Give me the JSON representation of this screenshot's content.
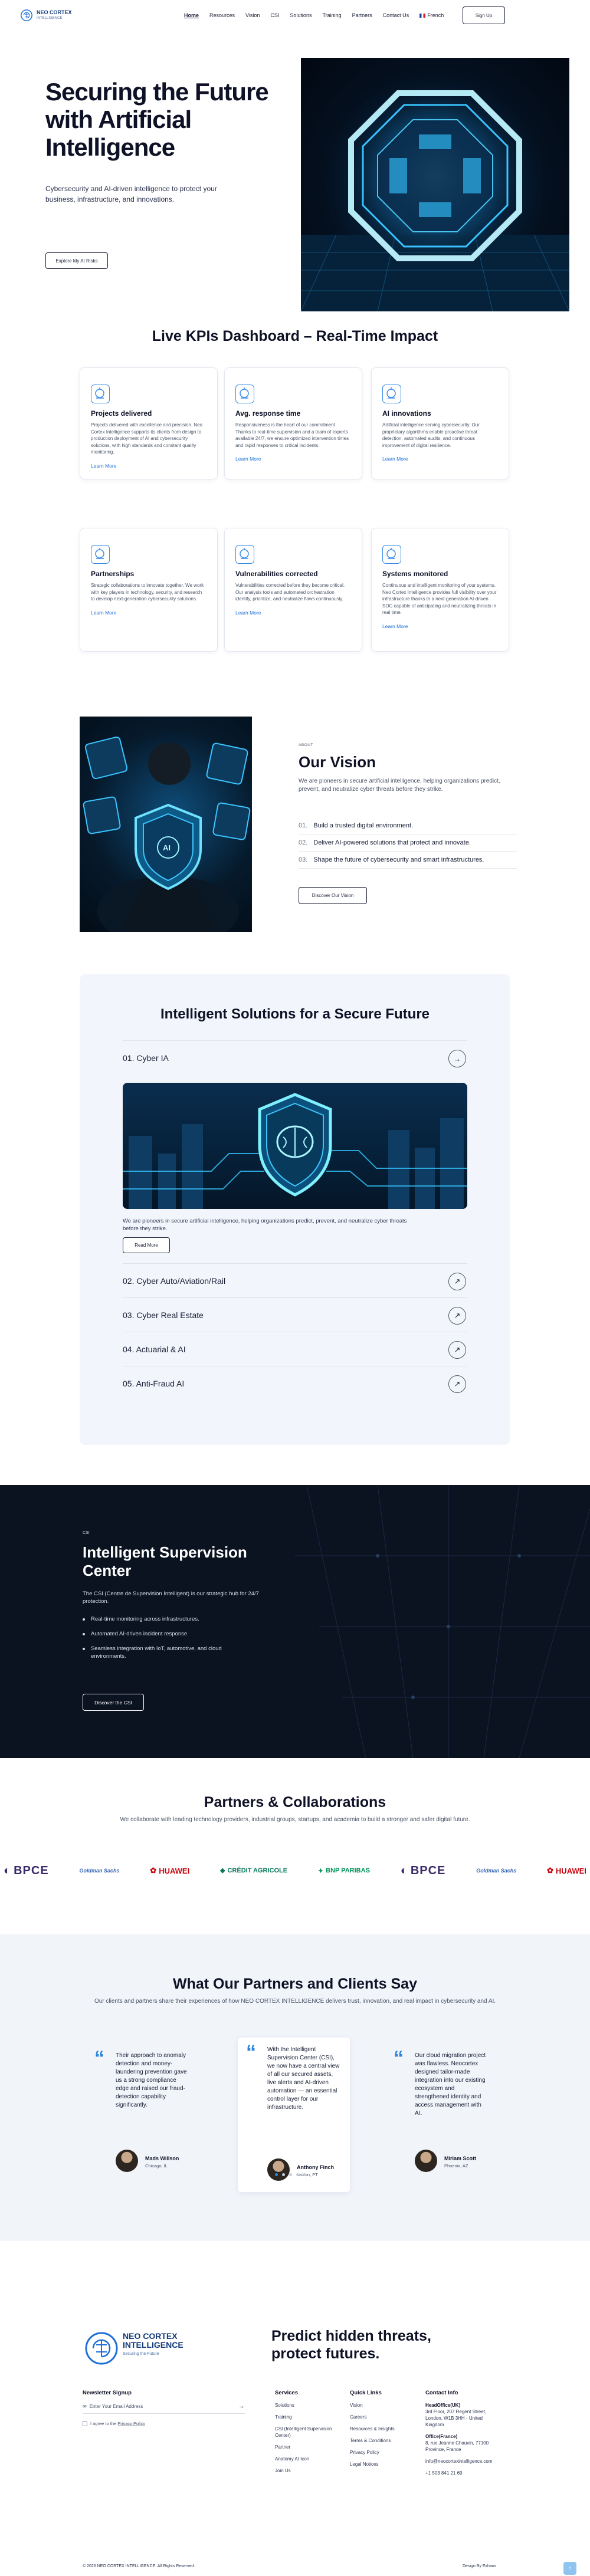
{
  "header": {
    "logo_line1": "NEO CORTEX",
    "logo_line2": "INTELLIGENCE",
    "nav": [
      "Home",
      "Resources",
      "Vision",
      "CSI",
      "Solutions",
      "Training",
      "Partners",
      "Contact Us"
    ],
    "lang": "French",
    "signup": "Sign Up"
  },
  "hero": {
    "title": "Securing the Future with Artificial Intelligence",
    "text": "Cybersecurity and AI-driven intelligence to protect your business, infrastructure, and innovations.",
    "button": "Explore My AI Risks"
  },
  "kpi": {
    "title": "Live KPIs Dashboard – Real-Time Impact",
    "learn_more": "Learn More",
    "cards": [
      {
        "icon": "magnifier-chart-icon",
        "title": "Projects delivered",
        "text": "Projects delivered with excellence and precision. Neo Cortex Intelligence supports its clients from design to production deployment of AI and cybersecurity solutions, with high standards and constant quality monitoring."
      },
      {
        "icon": "stopwatch-icon",
        "title": "Avg. response time",
        "text": "Responsiveness is the heart of our commitment. Thanks to real-time supervision and a team of experts available 24/7, we ensure optimized intervention times and rapid responses to critical incidents."
      },
      {
        "icon": "ai-chip-icon",
        "title": "AI innovations",
        "text": "Artificial intelligence serving cybersecurity. Our proprietary algorithms enable proactive threat detection, automated audits, and continuous improvement of digital resilience."
      },
      {
        "icon": "handshake-icon",
        "title": "Partnerships",
        "text": "Strategic collaborations to innovate together. We work with key players in technology, security, and research to develop next-generation cybersecurity solutions."
      },
      {
        "icon": "grid-shield-icon",
        "title": "Vulnerabilities corrected",
        "text": "Vulnerabilities corrected before they become critical. Our analysis tools and automated orchestration identify, prioritize, and neutralize flaws continuously."
      },
      {
        "icon": "monitor-gear-icon",
        "title": "Systems monitored",
        "text": "Continuous and intelligent monitoring of your systems. Neo Cortex Intelligence provides full visibility over your infrastructure thanks to a next-generation AI-driven SOC capable of anticipating and neutralizing threats in real time."
      }
    ]
  },
  "vision": {
    "small": "ABOUT",
    "title": "Our Vision",
    "text": "We are pioneers in secure artificial intelligence, helping organizations predict, prevent, and neutralize cyber threats before they strike.",
    "items": [
      {
        "num": "01.",
        "text": "Build a trusted digital environment."
      },
      {
        "num": "02.",
        "text": "Deliver AI-powered solutions that protect and innovate."
      },
      {
        "num": "03.",
        "text": "Shape the future of cybersecurity and smart infrastructures."
      }
    ],
    "button": "Discover Our Vision"
  },
  "solutions": {
    "title": "Intelligent Solutions for a Secure Future",
    "open": {
      "label": "01. Cyber IA",
      "desc": "We are pioneers in secure artificial intelligence, helping organizations predict, prevent, and neutralize cyber threats before they strike.",
      "button": "Read More"
    },
    "rows": [
      "02. Cyber Auto/Aviation/Rail",
      "03. Cyber Real Estate",
      "04. Actuarial & AI",
      "05. Anti-Fraud AI"
    ]
  },
  "csi": {
    "small": "CSI",
    "title": "Intelligent Supervision Center",
    "text": "The CSI (Centre de Supervision Intelligent) is our strategic hub for 24/7 protection.",
    "items": [
      "Real-time monitoring across infrastructures.",
      "Automated AI-driven incident response.",
      "Seamless integration with IoT, automotive, and cloud environments."
    ],
    "button": "Discover the CSI"
  },
  "partners": {
    "title": "Partners & Collaborations",
    "text": "We collaborate with leading technology providers, industrial groups, startups, and academia to build a stronger and safer digital future.",
    "logos": [
      {
        "cls": "bpce",
        "name": "BPCE"
      },
      {
        "cls": "gs",
        "name": "Goldman Sachs"
      },
      {
        "cls": "hw",
        "name": "HUAWEI"
      },
      {
        "cls": "ca",
        "name": "CRÉDIT AGRICOLE"
      },
      {
        "cls": "bnp",
        "name": "BNP PARIBAS"
      },
      {
        "cls": "bpce",
        "name": "BPCE"
      },
      {
        "cls": "gs",
        "name": "Goldman Sachs"
      },
      {
        "cls": "hw",
        "name": "HUAWEI"
      }
    ]
  },
  "testimonials": {
    "title": "What Our Partners and Clients Say",
    "text": "Our clients and partners share their experiences of how NEO CORTEX INTELLIGENCE delivers trust, innovation, and real impact in cybersecurity and AI.",
    "items": [
      {
        "quote": "Their approach to anomaly detection and money-laundering prevention gave us a strong compliance edge and raised our fraud-detection capability significantly.",
        "name": "Mads Willson",
        "loc": "Chicago, IL"
      },
      {
        "quote": "With the Intelligent Supervision Center (CSI), we now have a central view of all our secured assets, live alerts and AI-driven automation — an essential control layer for our infrastructure.",
        "name": "Anthony Finch",
        "loc": "Lisbon, PT"
      },
      {
        "quote": "Our cloud migration project was flawless. Neocortex designed tailor-made integration into our existing ecosystem and strengthened identity and access management with AI.",
        "name": "Miriam Scott",
        "loc": "Phoenix, AZ"
      }
    ]
  },
  "footer": {
    "logo_line1": "NEO CORTEX",
    "logo_line2": "INTELLIGENCE",
    "logo_line3": "Securing the Future",
    "headline": "Predict hidden threats, protect futures.",
    "newsletter": {
      "title": "Newsletter Signup",
      "placeholder": "Enter Your Email Address",
      "agree_prefix": "I agree to the ",
      "agree_link": "Privacy Policy"
    },
    "services": {
      "title": "Services",
      "items": [
        "Solutions",
        "Training",
        "CSI (Intelligent Supervision Center)",
        "Partner",
        "Anatomy AI Icon",
        "Join Us"
      ]
    },
    "links": {
      "title": "Quick Links",
      "items": [
        "Vision",
        "Careers",
        "Resources & Insights",
        "Terms & Conditions",
        "Privacy Policy",
        "Legal Notices"
      ]
    },
    "contact": {
      "title": "Contact Info",
      "hq": "HeadOffice(UK)",
      "hq_addr": "3rd Floor, 207 Regent Street, London, W1B 3HH - United Kingdom",
      "office": "Office(France)",
      "office_addr": "8, rue Jeanne Chauvin, 77100 Province, France",
      "email": "info@neocortexintelligence.com",
      "phone": "+1 503 841 21 69"
    },
    "copyright": "© 2026 NEO CORTEX INTELLIGENCE. All Rights Reserved.",
    "design": "Design By Exhaus"
  }
}
